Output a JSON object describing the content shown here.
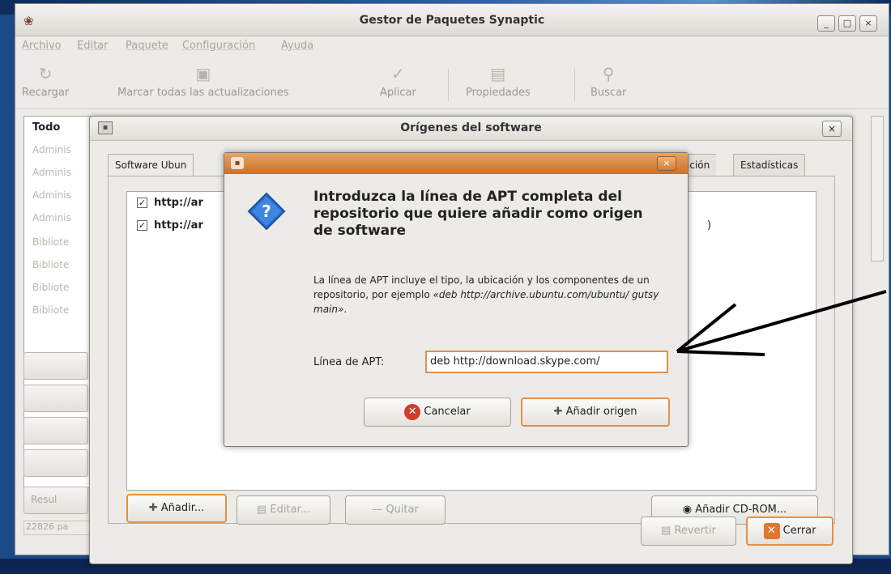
{
  "main_window": {
    "title": "Gestor de Paquetes Synaptic",
    "controls": {
      "minimize": "_",
      "maximize": "□",
      "close": "×"
    },
    "menu": [
      "Archivo",
      "Editar",
      "Paquete",
      "Configuración",
      "Ayuda"
    ],
    "toolbar": {
      "reload": "Recargar",
      "mark_all": "Marcar todas las actualizaciones",
      "apply": "Aplicar",
      "properties": "Propiedades",
      "search": "Buscar"
    },
    "categories": {
      "header": "Todo",
      "items": [
        "Adminis",
        "Adminis",
        "Adminis",
        "Adminis",
        "Bibliote",
        "Bibliote",
        "Bibliote",
        "Bibliote"
      ]
    },
    "filter_label": "Resul",
    "status": "22826 pa"
  },
  "sources_dialog": {
    "title": "Orígenes del software",
    "close": "×",
    "tabs": {
      "first": "Software Ubun",
      "partial": "ación",
      "last": "Estadísticas"
    },
    "repos": [
      {
        "checked": true,
        "text": "http://ar"
      },
      {
        "checked": true,
        "text": "http://ar"
      }
    ],
    "repo_tail": ")",
    "buttons": {
      "add": "Añadir...",
      "edit": "Editar...",
      "remove": "Quitar",
      "add_cdrom": "Añadir CD-ROM...",
      "revert": "Revertir",
      "close": "Cerrar"
    }
  },
  "apt_dialog": {
    "close": "×",
    "heading": "Introduzca la línea de APT completa del repositorio que quiere añadir como origen de software",
    "desc_prefix": "La línea de APT incluye el tipo, la ubicación y los componentes de un repositorio, por ejemplo ",
    "desc_example": "«deb http://archive.ubuntu.com/ubuntu/ gutsy main»",
    "desc_suffix": ".",
    "field_label": "Línea de APT:",
    "field_value": "deb http://download.skype.com/",
    "cancel": "Cancelar",
    "add_source": "Añadir origen"
  },
  "colors": {
    "focus_orange": "#e09148",
    "title_orange": "#c9712b",
    "question_blue": "#2a6fd0"
  }
}
